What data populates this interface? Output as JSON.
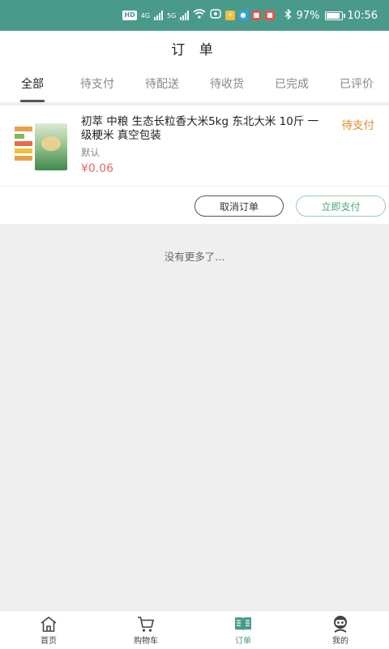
{
  "status_bar": {
    "left_chips": [
      "HD",
      "4G",
      "5G"
    ],
    "battery_percent": "97%",
    "battery_level": 0.97,
    "time": "10:56"
  },
  "header": {
    "title": "订 单"
  },
  "tabs": [
    {
      "label": "全部",
      "active": true
    },
    {
      "label": "待支付",
      "active": false
    },
    {
      "label": "待配送",
      "active": false
    },
    {
      "label": "待收货",
      "active": false
    },
    {
      "label": "已完成",
      "active": false
    },
    {
      "label": "已评价",
      "active": false
    }
  ],
  "order": {
    "product_title": "初萃 中粮 生态长粒香大米5kg 东北大米 10斤 一级粳米 真空包装",
    "status": "待支付",
    "spec": "默认",
    "price": "¥0.06",
    "cancel_label": "取消订单",
    "pay_label": "立即支付"
  },
  "list_footer": "没有更多了...",
  "bottom_nav": [
    {
      "label": "首页",
      "icon": "home-icon",
      "active": false
    },
    {
      "label": "购物车",
      "icon": "cart-icon",
      "active": false
    },
    {
      "label": "订单",
      "icon": "order-book-icon",
      "active": true
    },
    {
      "label": "我的",
      "icon": "profile-icon",
      "active": false
    }
  ],
  "colors": {
    "accent": "#4a9a8c",
    "status_pending": "#e08a2c",
    "price": "#e86a5a",
    "pay_button": "#4aa876"
  }
}
